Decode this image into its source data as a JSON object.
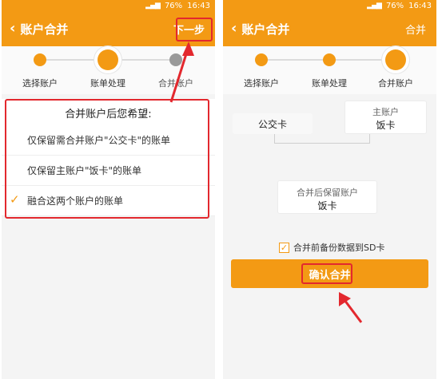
{
  "status": {
    "battery": "76%",
    "time": "16:43",
    "signal": "⁴ᴳ"
  },
  "left_screen": {
    "title": "账户合并",
    "next_label": "下一步",
    "steps": [
      "选择账户",
      "账单处理",
      "合并账户"
    ],
    "options_title": "合并账户后您希望:",
    "options": [
      "仅保留需合并账户\"公交卡\"的账单",
      "仅保留主账户\"饭卡\"的账单",
      "融合这两个账户的账单"
    ]
  },
  "right_screen": {
    "title": "账户合并",
    "action_label": "合并",
    "steps": [
      "选择账户",
      "账单处理",
      "合并账户"
    ],
    "source_account": "公交卡",
    "main_account_caption": "主账户",
    "main_account_name": "饭卡",
    "merged_caption": "合并后保留账户",
    "merged_name": "饭卡",
    "backup_label": "合并前备份数据到SD卡",
    "confirm_label": "确认合并"
  },
  "colors": {
    "accent": "#f39a14",
    "highlight": "#e3282e"
  }
}
